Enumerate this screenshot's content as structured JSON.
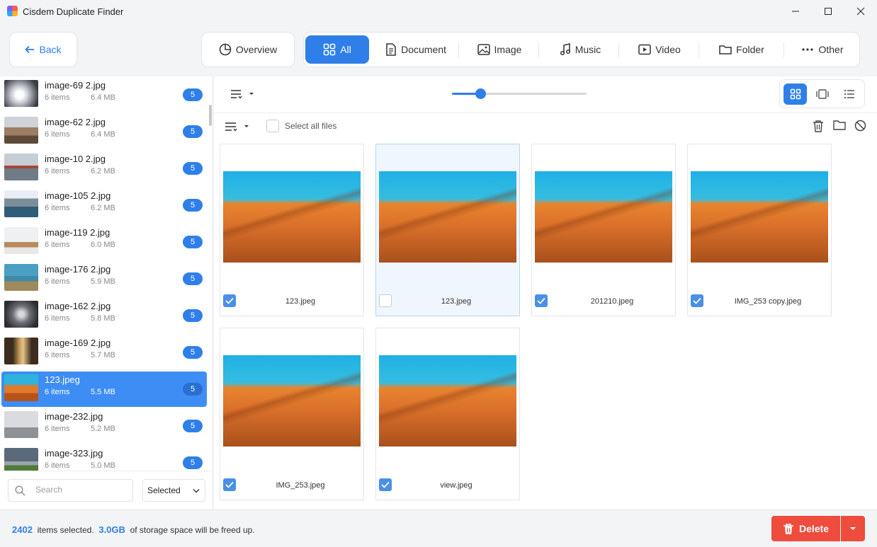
{
  "window": {
    "title": "Cisdem Duplicate Finder"
  },
  "toolbar": {
    "back_label": "Back",
    "overview_label": "Overview",
    "tabs": [
      {
        "label": "All",
        "icon": "grid-icon",
        "active": true
      },
      {
        "label": "Document",
        "icon": "document-icon",
        "active": false
      },
      {
        "label": "Image",
        "icon": "image-icon",
        "active": false
      },
      {
        "label": "Music",
        "icon": "music-icon",
        "active": false
      },
      {
        "label": "Video",
        "icon": "video-icon",
        "active": false
      },
      {
        "label": "Folder",
        "icon": "folder-icon",
        "active": false
      },
      {
        "label": "Other",
        "icon": "more-icon",
        "active": false
      }
    ]
  },
  "sidebar": {
    "groups": [
      {
        "name": "image-69 2.jpg",
        "count": "6 items",
        "size": "6.4 MB",
        "badge": "5",
        "thumb": "light-rays"
      },
      {
        "name": "image-62 2.jpg",
        "count": "6 items",
        "size": "6.4 MB",
        "badge": "5",
        "thumb": "person-hat"
      },
      {
        "name": "image-10 2.jpg",
        "count": "6 items",
        "size": "6.2 MB",
        "badge": "5",
        "thumb": "bridge-fog"
      },
      {
        "name": "image-105 2.jpg",
        "count": "6 items",
        "size": "6.2 MB",
        "badge": "5",
        "thumb": "mountain-lake"
      },
      {
        "name": "image-119 2.jpg",
        "count": "6 items",
        "size": "6.0 MB",
        "badge": "5",
        "thumb": "desk"
      },
      {
        "name": "image-176 2.jpg",
        "count": "6 items",
        "size": "5.9 MB",
        "badge": "5",
        "thumb": "coast"
      },
      {
        "name": "image-162 2.jpg",
        "count": "6 items",
        "size": "5.8 MB",
        "badge": "5",
        "thumb": "tunnel"
      },
      {
        "name": "image-169 2.jpg",
        "count": "6 items",
        "size": "5.7 MB",
        "badge": "5",
        "thumb": "corridor"
      },
      {
        "name": "123.jpeg",
        "count": "6 items",
        "size": "5.5 MB",
        "badge": "5",
        "thumb": "desert",
        "selected": true
      },
      {
        "name": "image-232.jpg",
        "count": "6 items",
        "size": "5.2 MB",
        "badge": "5",
        "thumb": "bird-sky"
      },
      {
        "name": "image-323.jpg",
        "count": "6 items",
        "size": "5.0 MB",
        "badge": "5",
        "thumb": "green-field"
      }
    ],
    "search_placeholder": "Search",
    "filter_value": "Selected"
  },
  "main": {
    "select_all_label": "Select all files",
    "slider_level": 0.21,
    "files": [
      {
        "name": "123.jpeg",
        "checked": true,
        "highlight": false
      },
      {
        "name": "123.jpeg",
        "checked": false,
        "highlight": true
      },
      {
        "name": "201210.jpeg",
        "checked": true,
        "highlight": false
      },
      {
        "name": "IMG_253 copy.jpeg",
        "checked": true,
        "highlight": false
      },
      {
        "name": "IMG_253.jpeg",
        "checked": true,
        "highlight": false
      },
      {
        "name": "view.jpeg",
        "checked": true,
        "highlight": false
      }
    ]
  },
  "status": {
    "selected_count": "2402",
    "selected_suffix": "items selected.",
    "space": "3.0GB",
    "space_suffix": "of storage space will be freed up."
  },
  "actions": {
    "delete_label": "Delete"
  },
  "colors": {
    "accent": "#2f7fe8",
    "delete": "#ee4c3c",
    "selected_row": "#3d8df5"
  }
}
